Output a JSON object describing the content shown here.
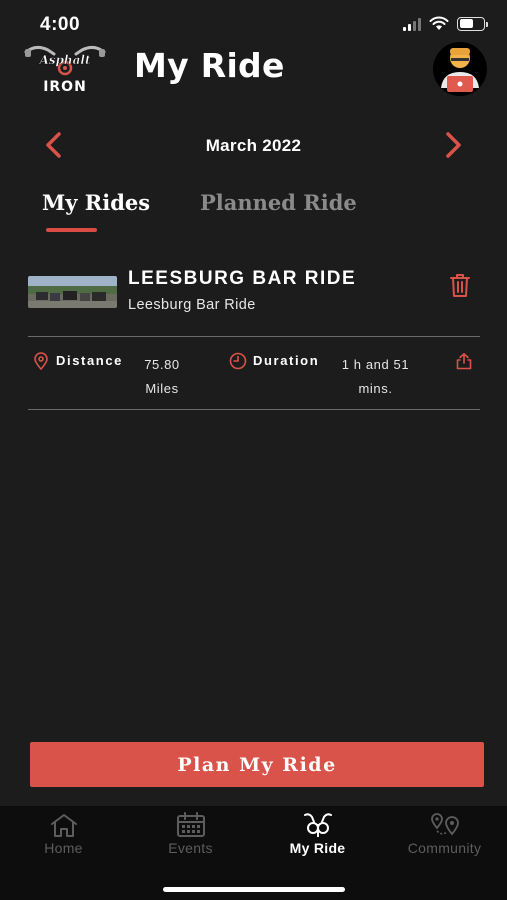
{
  "status_bar": {
    "time": "4:00"
  },
  "header": {
    "logo_text_top": "Asphalt",
    "logo_text_bottom": "IRON",
    "title": "My Ride"
  },
  "month_nav": {
    "label": "March 2022"
  },
  "tabs": [
    {
      "label": "My Rides",
      "active": true
    },
    {
      "label": "Planned Ride",
      "active": false
    }
  ],
  "ride": {
    "title": "LEESBURG BAR RIDE",
    "subtitle": "Leesburg Bar Ride",
    "distance_label": "Distance",
    "distance_value": "75.80 Miles",
    "duration_label": "Duration",
    "duration_value": "1 h and 51 mins."
  },
  "plan_button_label": "Plan My Ride",
  "bottom_nav": [
    {
      "label": "Home",
      "icon": "home-icon",
      "active": false
    },
    {
      "label": "Events",
      "icon": "calendar-icon",
      "active": false
    },
    {
      "label": "My Ride",
      "icon": "motorcycle-handlebar-icon",
      "active": true
    },
    {
      "label": "Community",
      "icon": "community-pins-icon",
      "active": false
    }
  ],
  "colors": {
    "accent": "#d9534a",
    "background": "#1c1c1c",
    "nav_background": "#0d0d0d",
    "inactive": "#5d5d5d"
  }
}
